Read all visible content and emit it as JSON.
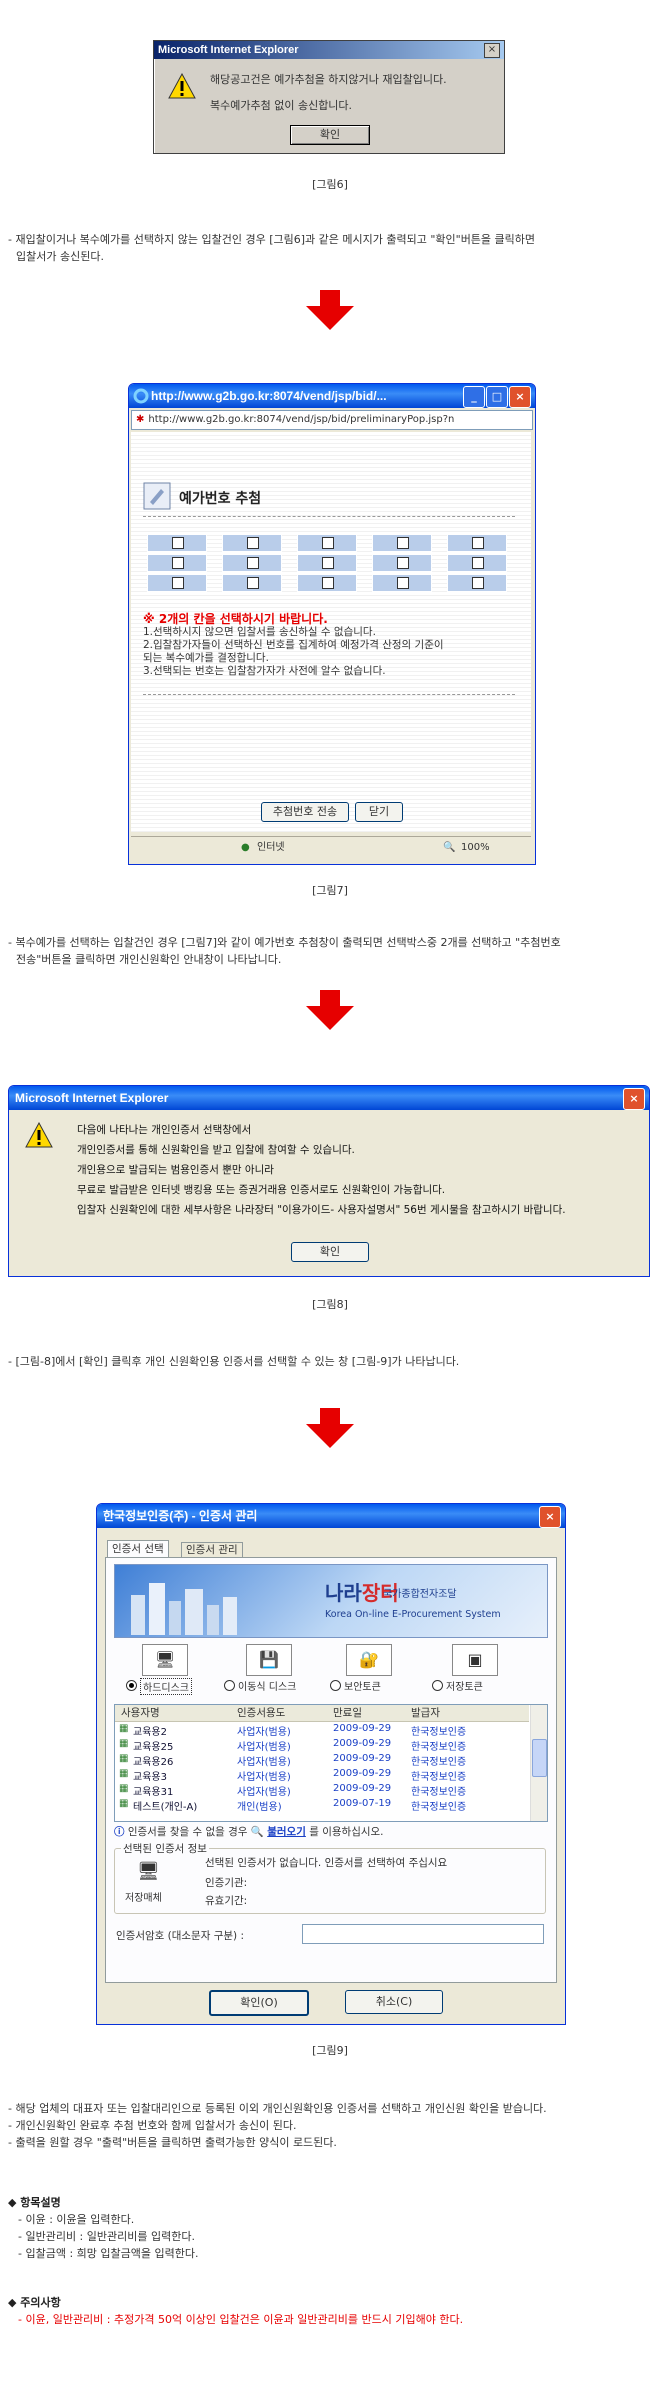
{
  "dialog6": {
    "title": "Microsoft Internet Explorer",
    "line1": "해당공고건은 예가추첨을 하지않거나 재입찰입니다.",
    "line2": "복수예가추첨 없이 송신합니다.",
    "ok": "확인",
    "caption": "[그림6]"
  },
  "para1": {
    "line1": "- 재입찰이거나 복수예가를 선택하지 않는 입찰건인 경우 [그림6]과 같은 메시지가 출력되고 \"확인\"버튼을 클릭하면",
    "line2": "입찰서가 송신된다."
  },
  "popup7": {
    "title": "http://www.g2b.go.kr:8074/vend/jsp/bid/...",
    "address": "http://www.g2b.go.kr:8074/vend/jsp/bid/preliminaryPop.jsp?n",
    "heading": "예가번호 추첨",
    "warning": "※ 2개의 칸을 선택하시기 바랍니다.",
    "note1": "1.선택하시지 않으면 입찰서를 송신하실 수 없습니다.",
    "note2": "2.입찰참가자들이 선택하신 번호를 집계하여 예정가격 산정의 기준이",
    "note3": "되는 복수예가를 결정합니다.",
    "note4": "3.선택되는 번호는 입찰참가자가 사전에 알수 없습니다.",
    "send": "추첨번호 전송",
    "close": "닫기",
    "status_zone": "인터넷",
    "zoom": "100%",
    "caption": "[그림7]"
  },
  "para2": {
    "line1": "- 복수예가를 선택하는 입찰건인 경우 [그림7]와 같이 예가번호 추첨창이 출력되면 선택박스중 2개를 선택하고 \"추첨번호",
    "line2": "전송\"버튼을 클릭하면 개인신원확인 안내창이 나타납니다."
  },
  "dialog8": {
    "title": "Microsoft Internet Explorer",
    "l1": "다음에 나타나는 개인인증서 선택창에서",
    "l2": "개인인증서를 통해 신원확인을 받고 입찰에 참여할 수 있습니다.",
    "l3": "개인용으로 발급되는 범용인증서 뿐만 아니라",
    "l4": "무료로 발급받은 인터넷 뱅킹용 또는 증권거래용 인증서로도 신원확인이 가능합니다.",
    "l5": "입찰자 신원확인에 대한 세부사항은 나라장터 \"이용가이드- 사용자설명서\" 56번 게시물을 참고하시기 바랍니다.",
    "ok": "확인",
    "caption": "[그림8]"
  },
  "para3": "- [그림-8]에서 [확인] 클릭후 개인 신원확인용 인증서를 선택할 수 있는 창 [그림-9]가 나타납니다.",
  "cert9": {
    "title": "한국정보인증(주) - 인증서 관리",
    "tab1": "인증서 선택",
    "tab2": "인증서 관리",
    "banner_brand1": "나라",
    "banner_brand2": "장터",
    "banner_sub": "국가종합전자조달",
    "banner_en": "Korea On-line E-Procurement System",
    "media": [
      "하드디스크",
      "이동식 디스크",
      "보안토큰",
      "저장토큰"
    ],
    "columns": [
      "사용자명",
      "인증서용도",
      "만료일",
      "발급자"
    ],
    "rows": [
      [
        "교육용2",
        "사업자(범용)",
        "2009-09-29",
        "한국정보인증"
      ],
      [
        "교육용25",
        "사업자(범용)",
        "2009-09-29",
        "한국정보인증"
      ],
      [
        "교육용26",
        "사업자(범용)",
        "2009-09-29",
        "한국정보인증"
      ],
      [
        "교육용3",
        "사업자(범용)",
        "2009-09-29",
        "한국정보인증"
      ],
      [
        "교육용31",
        "사업자(범용)",
        "2009-09-29",
        "한국정보인증"
      ],
      [
        "테스트(개인-A)",
        "개인(범용)",
        "2009-07-19",
        "한국정보인증"
      ]
    ],
    "find_text1": "인증서를 찾을 수 없을 경우",
    "find_link": "불러오기",
    "find_text2": "를 이용하십시오.",
    "info_legend": "선택된 인증서 정보",
    "info_media": "저장매체",
    "info_msg": "선택된 인증서가 없습니다. 인증서를 선택하여 주십시요",
    "info_issuer": "인증기관:",
    "info_valid": "유효기간:",
    "pw_label": "인증서암호 (대소문자 구분) :",
    "ok": "확인(O)",
    "cancel": "취소(C)",
    "caption": "[그림9]"
  },
  "para4": {
    "line1": "- 해당 업체의 대표자 또는 입찰대리인으로 등록된 이외 개인신원확인용 인증서를 선택하고 개인신원 확인을 받습니다.",
    "line2": "- 개인신원확인 완료후 추첨 번호와 함께 입찰서가 송신이 된다.",
    "line3": "- 출력을 원할 경우 \"출력\"버튼을 클릭하면 출력가능한 양식이 로드된다."
  },
  "items": {
    "heading": "◆ 항목설명",
    "i1": "- 이윤 : 이윤을 입력한다.",
    "i2": "- 일반관리비 : 일반관리비를 입력한다.",
    "i3": "- 입찰금액 : 희망 입찰금액을 입력한다."
  },
  "notice": {
    "heading": "◆ 주의사항",
    "text": "- 이윤, 일반관리비 : 추정가격 50억 이상인 입찰건은 이윤과 일반관리비를 반드시 기입해야 한다."
  },
  "colors": {
    "arrow": "#e60000",
    "xp_blue": "#0054e3",
    "classic_title": "#0a246a"
  }
}
